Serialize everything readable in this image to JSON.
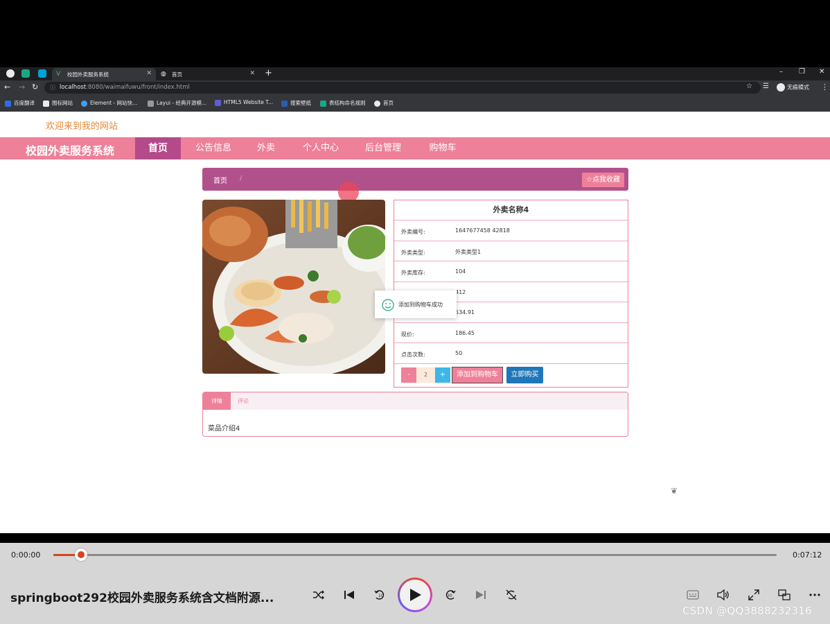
{
  "browser": {
    "tabs": [
      {
        "label": "校园外卖服务系统"
      },
      {
        "label": "首页"
      }
    ],
    "url_host": "localhost",
    "url_path": ":8080/waimaifuwu/front/index.html",
    "profile_label": "无痕模式",
    "bookmarks": [
      "百度翻译",
      "图标网站",
      "Element - 网站快...",
      "Layui - 经典开源模...",
      "HTML5 Website T...",
      "搜索壁纸",
      "表结构命名规则",
      "首页"
    ]
  },
  "site": {
    "welcome": "欢迎来到我的网站",
    "brand": "校园外卖服务系统",
    "nav": [
      "首页",
      "公告信息",
      "外卖",
      "个人中心",
      "后台管理",
      "购物车"
    ],
    "active_nav": "首页"
  },
  "breadcrumb": {
    "home": "首页",
    "sep": "/",
    "favorite_button": "☆点我收藏"
  },
  "product": {
    "title": "外卖名称4",
    "fields": [
      {
        "label": "外卖编号:",
        "value": "1647677458 42818"
      },
      {
        "label": "外卖类型:",
        "value": "外卖类型1"
      },
      {
        "label": "外卖库存:",
        "value": "104"
      },
      {
        "label": "",
        "value": "412"
      },
      {
        "label": "",
        "value": "534.91"
      },
      {
        "label": "现价:",
        "value": "186.45"
      },
      {
        "label": "点击次数:",
        "value": "50"
      }
    ],
    "quantity": "2",
    "minus": "-",
    "plus": "+",
    "add_to_cart": "添加到购物车",
    "buy_now": "立即购买"
  },
  "toast": {
    "message": "添加到购物车成功"
  },
  "tabs": {
    "detail": "详情",
    "comment": "评论",
    "content": "菜品介绍4"
  },
  "player": {
    "current_time": "0:00:00",
    "total_time": "0:07:12",
    "progress": 0.037,
    "title": "springboot292校园外卖服务系统含文档附源...",
    "watermark": "CSDN @QQ3888232316"
  },
  "colors": {
    "nav_pink": "#ee8099",
    "accent_purple": "#b54a8b",
    "buy_blue": "#1e77b8",
    "progress_red": "#d9431d"
  }
}
